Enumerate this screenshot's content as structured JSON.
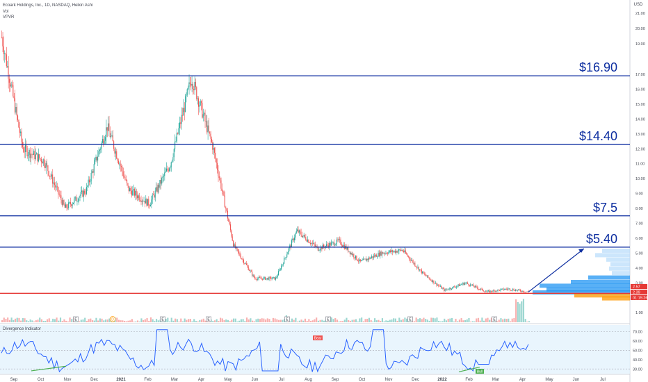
{
  "header": {
    "symbol_line": "Ecoark Holdings, Inc., 1D, NASDAQ, Heikin Ashi",
    "study_1": "Vol",
    "study_2": "VPVR",
    "currency": "USD"
  },
  "indicator": {
    "title": "Divergence Indicator",
    "bear_label": "Bear",
    "bull_label": "Bull",
    "price_axis": [
      "70.00",
      "60.00",
      "50.00",
      "40.00",
      "30.00"
    ],
    "levels": [
      70,
      50,
      30
    ],
    "background_color": "#e3f2fd",
    "line_color": "#2962ff"
  },
  "chart_data": {
    "type": "candlestick",
    "title": "Ecoark Holdings, Inc., 1D, NASDAQ, Heikin Ashi",
    "y_axis_labels": [
      "21.00",
      "20.00",
      "19.00",
      "17.00",
      "16.00",
      "15.00",
      "14.00",
      "13.00",
      "12.00",
      "11.00",
      "10.00",
      "9.00",
      "8.00",
      "7.00",
      "6.00",
      "5.00",
      "4.00",
      "3.00",
      "1.00"
    ],
    "x_axis_labels": [
      "Sep",
      "Oct",
      "Nov",
      "Dec",
      "2021",
      "Feb",
      "Mar",
      "Apr",
      "May",
      "Jun",
      "Jul",
      "Aug",
      "Sep",
      "Oct",
      "Nov",
      "Dec",
      "2022",
      "Feb",
      "Mar",
      "Apr",
      "May",
      "Jun",
      "Jul"
    ],
    "price_path": [
      {
        "date": "Aug",
        "price": 19.5
      },
      {
        "date": "Sep",
        "price": 12.0
      },
      {
        "date": "Oct",
        "price": 11.2
      },
      {
        "date": "Nov",
        "price": 8.0
      },
      {
        "date": "Dec",
        "price": 9.2
      },
      {
        "date": "2021",
        "price": 13.5
      },
      {
        "date": "Jan",
        "price": 9.3
      },
      {
        "date": "Feb",
        "price": 8.3
      },
      {
        "date": "Mar",
        "price": 11.0
      },
      {
        "date": "Mar",
        "price": 16.8
      },
      {
        "date": "Apr",
        "price": 12.2
      },
      {
        "date": "Apr",
        "price": 5.5
      },
      {
        "date": "May",
        "price": 3.3
      },
      {
        "date": "Jun",
        "price": 3.3
      },
      {
        "date": "Jun",
        "price": 6.5
      },
      {
        "date": "Jul",
        "price": 5.3
      },
      {
        "date": "Aug",
        "price": 5.8
      },
      {
        "date": "Aug",
        "price": 4.4
      },
      {
        "date": "Sep",
        "price": 5.0
      },
      {
        "date": "Oct",
        "price": 5.2
      },
      {
        "date": "Nov",
        "price": 3.6
      },
      {
        "date": "Dec",
        "price": 2.5
      },
      {
        "date": "2022",
        "price": 3.0
      },
      {
        "date": "Feb",
        "price": 2.4
      },
      {
        "date": "Mar",
        "price": 2.6
      },
      {
        "date": "Mar",
        "price": 2.39
      }
    ],
    "horizontal_levels": [
      {
        "label": "$16.90",
        "price": 16.9,
        "color": "#0d2ea0"
      },
      {
        "label": "$14.40",
        "price": 12.3,
        "color": "#0d2ea0"
      },
      {
        "label": "$7.5",
        "price": 7.5,
        "color": "#0d2ea0"
      },
      {
        "label": "$5.40",
        "price": 5.4,
        "color": "#0d2ea0"
      },
      {
        "label": "",
        "price": 2.3,
        "color": "#e53935"
      }
    ],
    "trend_arrow": {
      "from": {
        "date": "Mar",
        "price": 2.39
      },
      "to": {
        "date": "May",
        "price": 5.3
      }
    },
    "last_price_tags": [
      {
        "text": "2.57",
        "color": "#e53935"
      },
      {
        "text": "2.39",
        "color": "#e53935"
      },
      {
        "text": "01:15:26",
        "color": "#e53935"
      }
    ],
    "earnings_markers": [
      "E",
      "E",
      "E",
      "E",
      "E",
      "E",
      "E"
    ],
    "dividend_marker": "D",
    "colors": {
      "up": "#26a69a",
      "down": "#ef5350"
    }
  }
}
